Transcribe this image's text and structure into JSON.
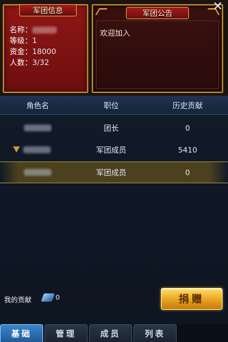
{
  "info": {
    "title": "军团信息",
    "name_label": "名称：",
    "level_label": "等级：",
    "level_value": "1",
    "funds_label": "资金：",
    "funds_value": "18000",
    "members_label": "人数：",
    "members_value": "3/32"
  },
  "notice": {
    "title": "军团公告",
    "text": "欢迎加入"
  },
  "close_icon": "✕",
  "table": {
    "headers": [
      "角色名",
      "职位",
      "历史贡献"
    ],
    "rows": [
      {
        "position": "团长",
        "contribution": "0",
        "selected": false,
        "icon": "none"
      },
      {
        "position": "军团成员",
        "contribution": "5410",
        "selected": false,
        "icon": "rank-badge-icon"
      },
      {
        "position": "军团成员",
        "contribution": "0",
        "selected": true,
        "icon": "none"
      }
    ]
  },
  "contribution": {
    "label": "我的贡献",
    "icon": "gem-icon",
    "value": "0"
  },
  "donate_label": "捐赠",
  "tabs": [
    "基础",
    "管理",
    "成员",
    "列表"
  ],
  "active_tab": 0,
  "colors": {
    "accent_gold": "#d9a23a",
    "info_red": "#8f1616",
    "active_tab_blue": "#3b86c9",
    "donate_gold": "#e8a21f"
  }
}
